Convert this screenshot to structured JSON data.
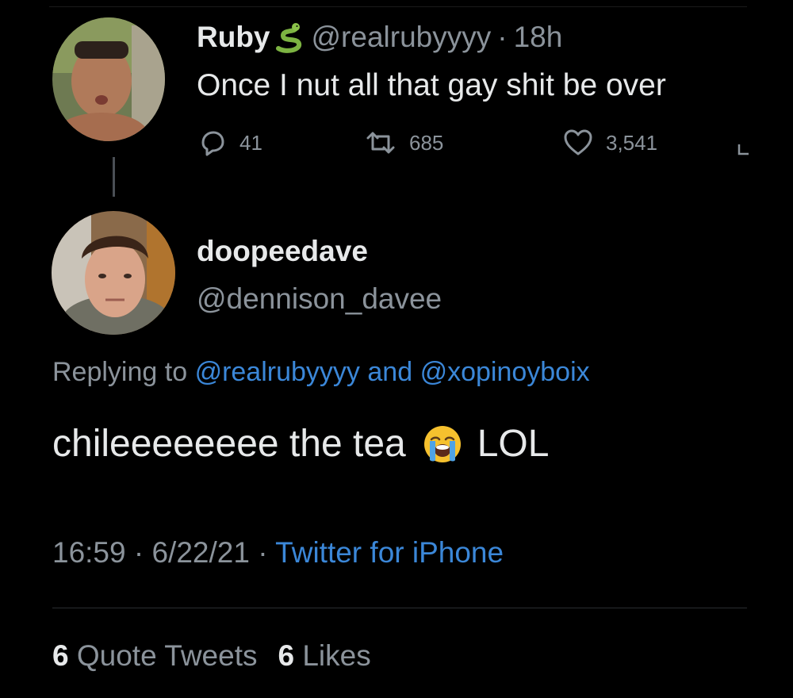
{
  "parent_tweet": {
    "display_name": "Ruby",
    "name_emoji": "snake-icon",
    "handle": "@realrubyyyy",
    "separator": "·",
    "time": "18h",
    "text": "Once I nut all that gay shit be over",
    "reply_count": "41",
    "retweet_count": "685",
    "like_count": "3,541"
  },
  "reply_tweet": {
    "display_name": "doopeedave",
    "handle": "@dennison_davee",
    "replying_prefix": "Replying to",
    "replying_mention_1": "@realrubyyyy",
    "replying_and": "and",
    "replying_mention_2": "@xopinoyboix",
    "text_before_emoji": "chileeeeeeee the tea",
    "emoji": "loudly-crying-face-icon",
    "text_after_emoji": "LOL",
    "time": "16:59",
    "separator": "·",
    "date": "6/22/21",
    "source": "Twitter for iPhone",
    "quote_tweets_count": "6",
    "quote_tweets_label": "Quote Tweets",
    "likes_count": "6",
    "likes_label": "Likes"
  },
  "colors": {
    "background": "#000000",
    "text_primary": "#e7e9ea",
    "text_secondary": "#8b939b",
    "link": "#3b87d8"
  }
}
